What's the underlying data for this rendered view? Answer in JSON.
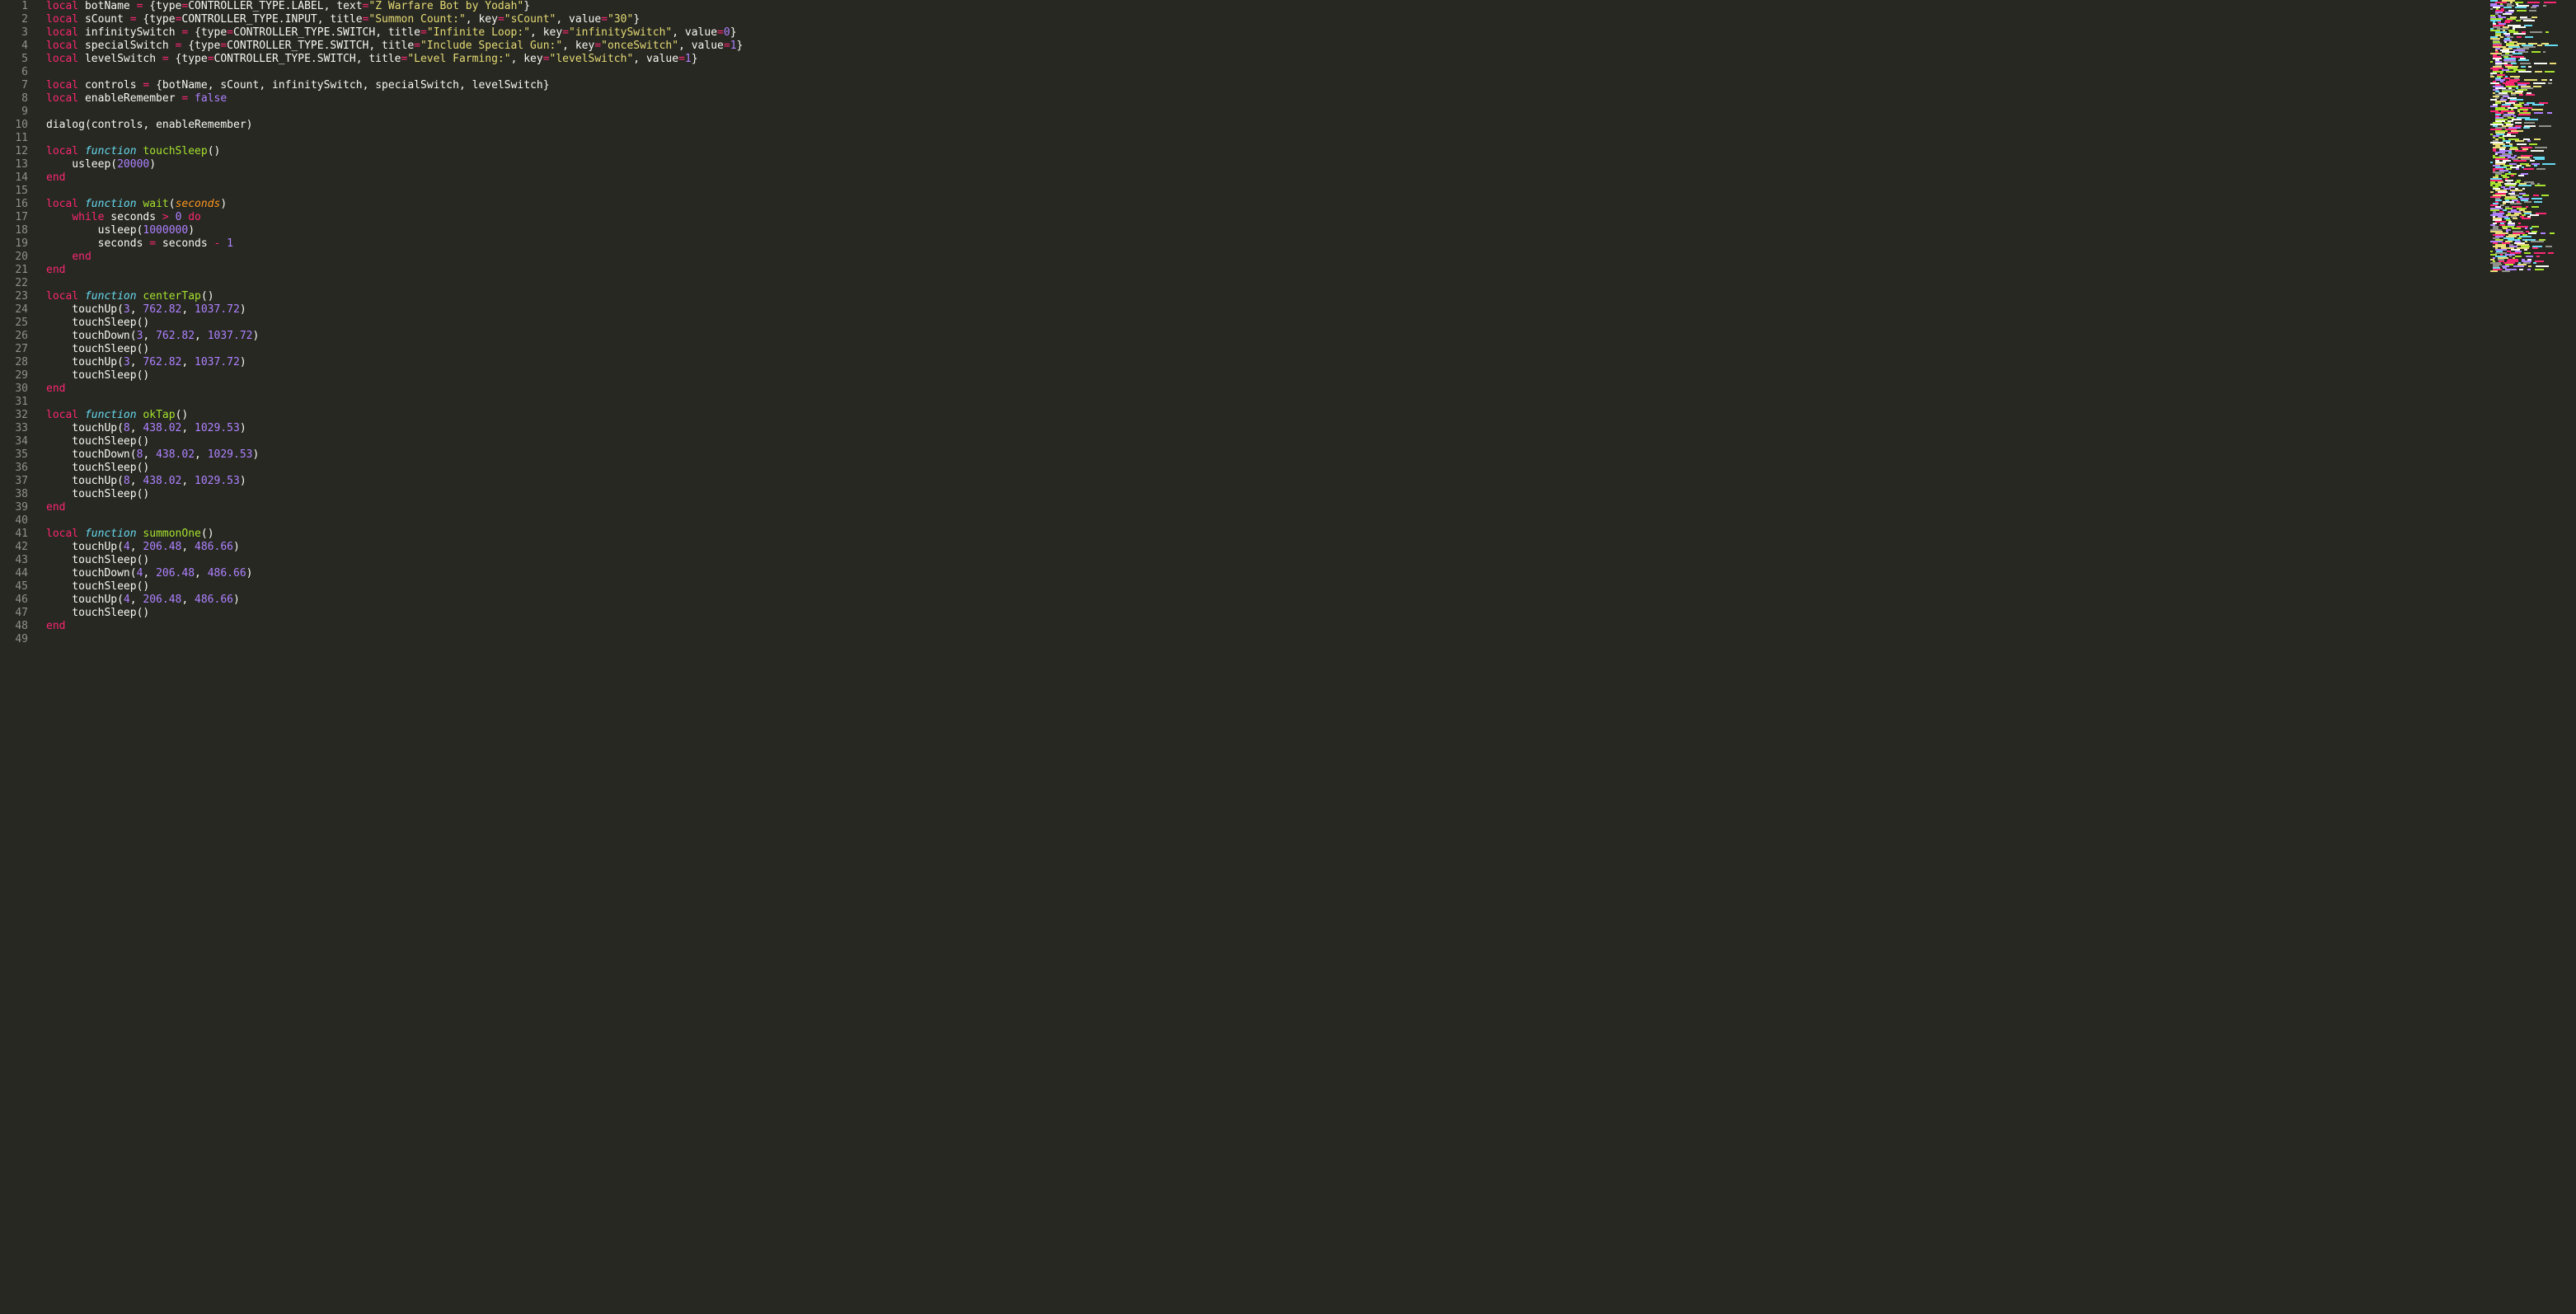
{
  "lines": [
    {
      "n": 1,
      "tokens": [
        [
          "kw",
          "local"
        ],
        [
          "ident",
          " botName "
        ],
        [
          "op",
          "="
        ],
        [
          "punc",
          " {"
        ],
        [
          "ident",
          "type"
        ],
        [
          "op",
          "="
        ],
        [
          "ident",
          "CONTROLLER_TYPE.LABEL"
        ],
        [
          "punc",
          ", "
        ],
        [
          "ident",
          "text"
        ],
        [
          "op",
          "="
        ],
        [
          "str",
          "\"Z Warfare Bot by Yodah\""
        ],
        [
          "punc",
          "}"
        ]
      ]
    },
    {
      "n": 2,
      "tokens": [
        [
          "kw",
          "local"
        ],
        [
          "ident",
          " sCount "
        ],
        [
          "op",
          "="
        ],
        [
          "punc",
          " {"
        ],
        [
          "ident",
          "type"
        ],
        [
          "op",
          "="
        ],
        [
          "ident",
          "CONTROLLER_TYPE.INPUT"
        ],
        [
          "punc",
          ", "
        ],
        [
          "ident",
          "title"
        ],
        [
          "op",
          "="
        ],
        [
          "str",
          "\"Summon Count:\""
        ],
        [
          "punc",
          ", "
        ],
        [
          "ident",
          "key"
        ],
        [
          "op",
          "="
        ],
        [
          "str",
          "\"sCount\""
        ],
        [
          "punc",
          ", "
        ],
        [
          "ident",
          "value"
        ],
        [
          "op",
          "="
        ],
        [
          "str",
          "\"30\""
        ],
        [
          "punc",
          "}"
        ]
      ]
    },
    {
      "n": 3,
      "tokens": [
        [
          "kw",
          "local"
        ],
        [
          "ident",
          " infinitySwitch "
        ],
        [
          "op",
          "="
        ],
        [
          "punc",
          " {"
        ],
        [
          "ident",
          "type"
        ],
        [
          "op",
          "="
        ],
        [
          "ident",
          "CONTROLLER_TYPE.SWITCH"
        ],
        [
          "punc",
          ", "
        ],
        [
          "ident",
          "title"
        ],
        [
          "op",
          "="
        ],
        [
          "str",
          "\"Infinite Loop:\""
        ],
        [
          "punc",
          ", "
        ],
        [
          "ident",
          "key"
        ],
        [
          "op",
          "="
        ],
        [
          "str",
          "\"infinitySwitch\""
        ],
        [
          "punc",
          ", "
        ],
        [
          "ident",
          "value"
        ],
        [
          "op",
          "="
        ],
        [
          "num",
          "0"
        ],
        [
          "punc",
          "}"
        ]
      ]
    },
    {
      "n": 4,
      "tokens": [
        [
          "kw",
          "local"
        ],
        [
          "ident",
          " specialSwitch "
        ],
        [
          "op",
          "="
        ],
        [
          "punc",
          " {"
        ],
        [
          "ident",
          "type"
        ],
        [
          "op",
          "="
        ],
        [
          "ident",
          "CONTROLLER_TYPE.SWITCH"
        ],
        [
          "punc",
          ", "
        ],
        [
          "ident",
          "title"
        ],
        [
          "op",
          "="
        ],
        [
          "str",
          "\"Include Special Gun:\""
        ],
        [
          "punc",
          ", "
        ],
        [
          "ident",
          "key"
        ],
        [
          "op",
          "="
        ],
        [
          "str",
          "\"onceSwitch\""
        ],
        [
          "punc",
          ", "
        ],
        [
          "ident",
          "value"
        ],
        [
          "op",
          "="
        ],
        [
          "num",
          "1"
        ],
        [
          "punc",
          "}"
        ]
      ]
    },
    {
      "n": 5,
      "tokens": [
        [
          "kw",
          "local"
        ],
        [
          "ident",
          " levelSwitch "
        ],
        [
          "op",
          "="
        ],
        [
          "punc",
          " {"
        ],
        [
          "ident",
          "type"
        ],
        [
          "op",
          "="
        ],
        [
          "ident",
          "CONTROLLER_TYPE.SWITCH"
        ],
        [
          "punc",
          ", "
        ],
        [
          "ident",
          "title"
        ],
        [
          "op",
          "="
        ],
        [
          "str",
          "\"Level Farming:\""
        ],
        [
          "punc",
          ", "
        ],
        [
          "ident",
          "key"
        ],
        [
          "op",
          "="
        ],
        [
          "str",
          "\"levelSwitch\""
        ],
        [
          "punc",
          ", "
        ],
        [
          "ident",
          "value"
        ],
        [
          "op",
          "="
        ],
        [
          "num",
          "1"
        ],
        [
          "punc",
          "}"
        ]
      ]
    },
    {
      "n": 6,
      "tokens": []
    },
    {
      "n": 7,
      "tokens": [
        [
          "kw",
          "local"
        ],
        [
          "ident",
          " controls "
        ],
        [
          "op",
          "="
        ],
        [
          "punc",
          " {"
        ],
        [
          "ident",
          "botName"
        ],
        [
          "punc",
          ", "
        ],
        [
          "ident",
          "sCount"
        ],
        [
          "punc",
          ", "
        ],
        [
          "ident",
          "infinitySwitch"
        ],
        [
          "punc",
          ", "
        ],
        [
          "ident",
          "specialSwitch"
        ],
        [
          "punc",
          ", "
        ],
        [
          "ident",
          "levelSwitch"
        ],
        [
          "punc",
          "}"
        ]
      ]
    },
    {
      "n": 8,
      "tokens": [
        [
          "kw",
          "local"
        ],
        [
          "ident",
          " enableRemember "
        ],
        [
          "op",
          "="
        ],
        [
          "punc",
          " "
        ],
        [
          "num",
          "false"
        ]
      ]
    },
    {
      "n": 9,
      "tokens": []
    },
    {
      "n": 10,
      "tokens": [
        [
          "ident",
          "dialog"
        ],
        [
          "punc",
          "("
        ],
        [
          "ident",
          "controls"
        ],
        [
          "punc",
          ", "
        ],
        [
          "ident",
          "enableRemember"
        ],
        [
          "punc",
          ")"
        ]
      ]
    },
    {
      "n": 11,
      "tokens": []
    },
    {
      "n": 12,
      "tokens": [
        [
          "kw",
          "local"
        ],
        [
          "punc",
          " "
        ],
        [
          "kw2",
          "function"
        ],
        [
          "punc",
          " "
        ],
        [
          "fn",
          "touchSleep"
        ],
        [
          "punc",
          "()"
        ]
      ]
    },
    {
      "n": 13,
      "tokens": [
        [
          "ident",
          "    usleep"
        ],
        [
          "punc",
          "("
        ],
        [
          "num",
          "20000"
        ],
        [
          "punc",
          ")"
        ]
      ]
    },
    {
      "n": 14,
      "tokens": [
        [
          "kw",
          "end"
        ]
      ]
    },
    {
      "n": 15,
      "tokens": []
    },
    {
      "n": 16,
      "tokens": [
        [
          "kw",
          "local"
        ],
        [
          "punc",
          " "
        ],
        [
          "kw2",
          "function"
        ],
        [
          "punc",
          " "
        ],
        [
          "fn",
          "wait"
        ],
        [
          "punc",
          "("
        ],
        [
          "param",
          "seconds"
        ],
        [
          "punc",
          ")"
        ]
      ]
    },
    {
      "n": 17,
      "tokens": [
        [
          "punc",
          "    "
        ],
        [
          "kw",
          "while"
        ],
        [
          "ident",
          " seconds "
        ],
        [
          "op",
          ">"
        ],
        [
          "punc",
          " "
        ],
        [
          "num",
          "0"
        ],
        [
          "punc",
          " "
        ],
        [
          "kw",
          "do"
        ]
      ]
    },
    {
      "n": 18,
      "tokens": [
        [
          "ident",
          "        usleep"
        ],
        [
          "punc",
          "("
        ],
        [
          "num",
          "1000000"
        ],
        [
          "punc",
          ")"
        ]
      ]
    },
    {
      "n": 19,
      "tokens": [
        [
          "ident",
          "        seconds "
        ],
        [
          "op",
          "="
        ],
        [
          "ident",
          " seconds "
        ],
        [
          "op",
          "-"
        ],
        [
          "punc",
          " "
        ],
        [
          "num",
          "1"
        ]
      ]
    },
    {
      "n": 20,
      "tokens": [
        [
          "punc",
          "    "
        ],
        [
          "kw",
          "end"
        ]
      ]
    },
    {
      "n": 21,
      "tokens": [
        [
          "kw",
          "end"
        ]
      ]
    },
    {
      "n": 22,
      "tokens": []
    },
    {
      "n": 23,
      "tokens": [
        [
          "kw",
          "local"
        ],
        [
          "punc",
          " "
        ],
        [
          "kw2",
          "function"
        ],
        [
          "punc",
          " "
        ],
        [
          "fn",
          "centerTap"
        ],
        [
          "punc",
          "()"
        ]
      ]
    },
    {
      "n": 24,
      "tokens": [
        [
          "ident",
          "    touchUp"
        ],
        [
          "punc",
          "("
        ],
        [
          "num",
          "3"
        ],
        [
          "punc",
          ", "
        ],
        [
          "num",
          "762.82"
        ],
        [
          "punc",
          ", "
        ],
        [
          "num",
          "1037.72"
        ],
        [
          "punc",
          ")"
        ]
      ]
    },
    {
      "n": 25,
      "tokens": [
        [
          "ident",
          "    touchSleep"
        ],
        [
          "punc",
          "()"
        ]
      ]
    },
    {
      "n": 26,
      "tokens": [
        [
          "ident",
          "    touchDown"
        ],
        [
          "punc",
          "("
        ],
        [
          "num",
          "3"
        ],
        [
          "punc",
          ", "
        ],
        [
          "num",
          "762.82"
        ],
        [
          "punc",
          ", "
        ],
        [
          "num",
          "1037.72"
        ],
        [
          "punc",
          ")"
        ]
      ]
    },
    {
      "n": 27,
      "tokens": [
        [
          "ident",
          "    touchSleep"
        ],
        [
          "punc",
          "()"
        ]
      ]
    },
    {
      "n": 28,
      "tokens": [
        [
          "ident",
          "    touchUp"
        ],
        [
          "punc",
          "("
        ],
        [
          "num",
          "3"
        ],
        [
          "punc",
          ", "
        ],
        [
          "num",
          "762.82"
        ],
        [
          "punc",
          ", "
        ],
        [
          "num",
          "1037.72"
        ],
        [
          "punc",
          ")"
        ]
      ]
    },
    {
      "n": 29,
      "tokens": [
        [
          "ident",
          "    touchSleep"
        ],
        [
          "punc",
          "()"
        ]
      ]
    },
    {
      "n": 30,
      "tokens": [
        [
          "kw",
          "end"
        ]
      ]
    },
    {
      "n": 31,
      "tokens": []
    },
    {
      "n": 32,
      "tokens": [
        [
          "kw",
          "local"
        ],
        [
          "punc",
          " "
        ],
        [
          "kw2",
          "function"
        ],
        [
          "punc",
          " "
        ],
        [
          "fn",
          "okTap"
        ],
        [
          "punc",
          "()"
        ]
      ]
    },
    {
      "n": 33,
      "tokens": [
        [
          "ident",
          "    touchUp"
        ],
        [
          "punc",
          "("
        ],
        [
          "num",
          "8"
        ],
        [
          "punc",
          ", "
        ],
        [
          "num",
          "438.02"
        ],
        [
          "punc",
          ", "
        ],
        [
          "num",
          "1029.53"
        ],
        [
          "punc",
          ")"
        ]
      ]
    },
    {
      "n": 34,
      "tokens": [
        [
          "ident",
          "    touchSleep"
        ],
        [
          "punc",
          "()"
        ]
      ]
    },
    {
      "n": 35,
      "tokens": [
        [
          "ident",
          "    touchDown"
        ],
        [
          "punc",
          "("
        ],
        [
          "num",
          "8"
        ],
        [
          "punc",
          ", "
        ],
        [
          "num",
          "438.02"
        ],
        [
          "punc",
          ", "
        ],
        [
          "num",
          "1029.53"
        ],
        [
          "punc",
          ")"
        ]
      ]
    },
    {
      "n": 36,
      "tokens": [
        [
          "ident",
          "    touchSleep"
        ],
        [
          "punc",
          "()"
        ]
      ]
    },
    {
      "n": 37,
      "tokens": [
        [
          "ident",
          "    touchUp"
        ],
        [
          "punc",
          "("
        ],
        [
          "num",
          "8"
        ],
        [
          "punc",
          ", "
        ],
        [
          "num",
          "438.02"
        ],
        [
          "punc",
          ", "
        ],
        [
          "num",
          "1029.53"
        ],
        [
          "punc",
          ")"
        ]
      ]
    },
    {
      "n": 38,
      "tokens": [
        [
          "ident",
          "    touchSleep"
        ],
        [
          "punc",
          "()"
        ]
      ]
    },
    {
      "n": 39,
      "tokens": [
        [
          "kw",
          "end"
        ]
      ]
    },
    {
      "n": 40,
      "tokens": []
    },
    {
      "n": 41,
      "tokens": [
        [
          "kw",
          "local"
        ],
        [
          "punc",
          " "
        ],
        [
          "kw2",
          "function"
        ],
        [
          "punc",
          " "
        ],
        [
          "fn",
          "summonOne"
        ],
        [
          "punc",
          "()"
        ]
      ]
    },
    {
      "n": 42,
      "tokens": [
        [
          "ident",
          "    touchUp"
        ],
        [
          "punc",
          "("
        ],
        [
          "num",
          "4"
        ],
        [
          "punc",
          ", "
        ],
        [
          "num",
          "206.48"
        ],
        [
          "punc",
          ", "
        ],
        [
          "num",
          "486.66"
        ],
        [
          "punc",
          ")"
        ]
      ]
    },
    {
      "n": 43,
      "tokens": [
        [
          "ident",
          "    touchSleep"
        ],
        [
          "punc",
          "()"
        ]
      ]
    },
    {
      "n": 44,
      "tokens": [
        [
          "ident",
          "    touchDown"
        ],
        [
          "punc",
          "("
        ],
        [
          "num",
          "4"
        ],
        [
          "punc",
          ", "
        ],
        [
          "num",
          "206.48"
        ],
        [
          "punc",
          ", "
        ],
        [
          "num",
          "486.66"
        ],
        [
          "punc",
          ")"
        ]
      ]
    },
    {
      "n": 45,
      "tokens": [
        [
          "ident",
          "    touchSleep"
        ],
        [
          "punc",
          "()"
        ]
      ]
    },
    {
      "n": 46,
      "tokens": [
        [
          "ident",
          "    touchUp"
        ],
        [
          "punc",
          "("
        ],
        [
          "num",
          "4"
        ],
        [
          "punc",
          ", "
        ],
        [
          "num",
          "206.48"
        ],
        [
          "punc",
          ", "
        ],
        [
          "num",
          "486.66"
        ],
        [
          "punc",
          ")"
        ]
      ]
    },
    {
      "n": 47,
      "tokens": [
        [
          "ident",
          "    touchSleep"
        ],
        [
          "punc",
          "()"
        ]
      ]
    },
    {
      "n": 48,
      "tokens": [
        [
          "kw",
          "end"
        ]
      ]
    },
    {
      "n": 49,
      "tokens": []
    }
  ],
  "minimap_rows": 165
}
